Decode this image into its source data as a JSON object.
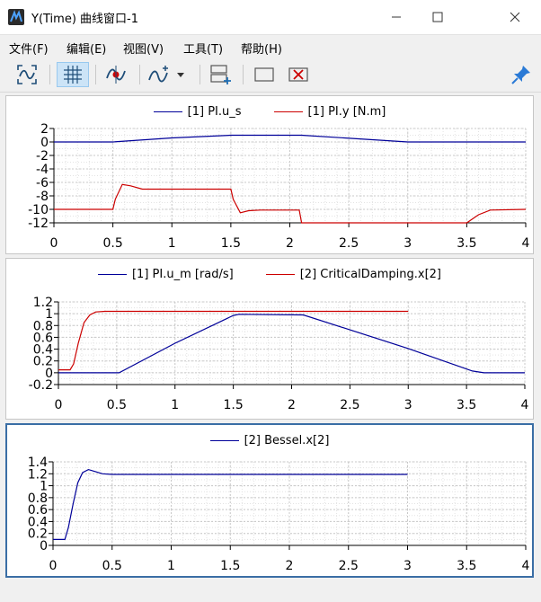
{
  "window": {
    "title": "Y(Time) 曲线窗口-1"
  },
  "menu": [
    {
      "label": "文件(F)"
    },
    {
      "label": "编辑(E)"
    },
    {
      "label": "视图(V)"
    },
    {
      "label": "工具(T)"
    },
    {
      "label": "帮助(H)"
    }
  ],
  "toolbar": {
    "buttons": [
      {
        "icon": "zoom-fit-icon"
      },
      {
        "icon": "grid-icon",
        "active": true
      },
      {
        "icon": "curve-cursor-icon"
      },
      {
        "icon": "add-curve-icon"
      },
      {
        "icon": "add-subplot-icon"
      },
      {
        "icon": "rectangle-icon"
      },
      {
        "icon": "delete-subplot-icon"
      },
      {
        "icon": "pin-icon"
      }
    ]
  },
  "colors": {
    "blue": "#000099",
    "red": "#cc0000",
    "grid": "#d8d8d8",
    "accent": "#3a6ea5"
  },
  "chart_data": [
    {
      "type": "line",
      "legend": [
        {
          "name": "[1] PI.u_s",
          "color": "#000099"
        },
        {
          "name": "[1] PI.y [N.m]",
          "color": "#cc0000"
        }
      ],
      "xlim": [
        0,
        4
      ],
      "ylim": [
        -12,
        2
      ],
      "xticks": [
        0,
        0.5,
        1,
        1.5,
        2,
        2.5,
        3,
        3.5,
        4
      ],
      "yticks": [
        2,
        0,
        -2,
        -4,
        -6,
        -8,
        -10,
        -12
      ],
      "series": [
        {
          "name": "[1] PI.u_s",
          "color": "#000099",
          "x": [
            0,
            0.5,
            1.0,
            1.5,
            2.1,
            3.0,
            4.0
          ],
          "y": [
            0,
            0,
            0.6,
            1.0,
            1.0,
            0,
            0
          ]
        },
        {
          "name": "[1] PI.y [N.m]",
          "color": "#cc0000",
          "x": [
            0,
            0.5,
            0.52,
            0.58,
            0.65,
            0.75,
            1.0,
            1.5,
            1.52,
            1.58,
            1.65,
            1.75,
            2.08,
            2.1,
            3.0,
            3.5,
            3.6,
            3.7,
            4.0
          ],
          "y": [
            -10,
            -10,
            -8.5,
            -6.3,
            -6.5,
            -7.0,
            -7.0,
            -7.0,
            -8.5,
            -10.5,
            -10.2,
            -10.1,
            -10.1,
            -12,
            -12,
            -12,
            -10.8,
            -10.1,
            -10
          ]
        }
      ]
    },
    {
      "type": "line",
      "legend": [
        {
          "name": "[1] PI.u_m [rad/s]",
          "color": "#000099"
        },
        {
          "name": "[2] CriticalDamping.x[2]",
          "color": "#cc0000"
        }
      ],
      "xlim": [
        0,
        4
      ],
      "ylim": [
        -0.2,
        1.2
      ],
      "xticks": [
        0,
        0.5,
        1,
        1.5,
        2,
        2.5,
        3,
        3.5,
        4
      ],
      "yticks": [
        1.2,
        1,
        0.8,
        0.6,
        0.4,
        0.2,
        0,
        -0.2
      ],
      "series": [
        {
          "name": "[1] PI.u_m [rad/s]",
          "color": "#000099",
          "x": [
            0,
            0.52,
            1.0,
            1.5,
            1.55,
            2.1,
            3.0,
            3.55,
            3.65,
            4.0
          ],
          "y": [
            0,
            0,
            0.5,
            0.97,
            0.99,
            0.98,
            0.41,
            0.03,
            0,
            0
          ]
        },
        {
          "name": "[2] CriticalDamping.x[2]",
          "color": "#cc0000",
          "x": [
            0,
            0.1,
            0.13,
            0.17,
            0.22,
            0.27,
            0.32,
            0.4,
            0.5,
            1.0,
            3.0
          ],
          "y": [
            0.05,
            0.05,
            0.15,
            0.5,
            0.85,
            0.98,
            1.03,
            1.04,
            1.04,
            1.04,
            1.04
          ]
        }
      ]
    },
    {
      "type": "line",
      "legend": [
        {
          "name": "[2] Bessel.x[2]",
          "color": "#000099"
        }
      ],
      "xlim": [
        0,
        4
      ],
      "ylim": [
        0,
        1.4
      ],
      "xticks": [
        0,
        0.5,
        1,
        1.5,
        2,
        2.5,
        3,
        3.5,
        4
      ],
      "yticks": [
        1.4,
        1.2,
        1,
        0.8,
        0.6,
        0.4,
        0.2,
        0
      ],
      "series": [
        {
          "name": "[2] Bessel.x[2]",
          "color": "#000099",
          "x": [
            0,
            0.1,
            0.13,
            0.17,
            0.21,
            0.25,
            0.3,
            0.35,
            0.42,
            0.5,
            1.0,
            3.0
          ],
          "y": [
            0.1,
            0.1,
            0.3,
            0.7,
            1.05,
            1.22,
            1.27,
            1.24,
            1.2,
            1.19,
            1.19,
            1.19
          ]
        }
      ]
    }
  ]
}
